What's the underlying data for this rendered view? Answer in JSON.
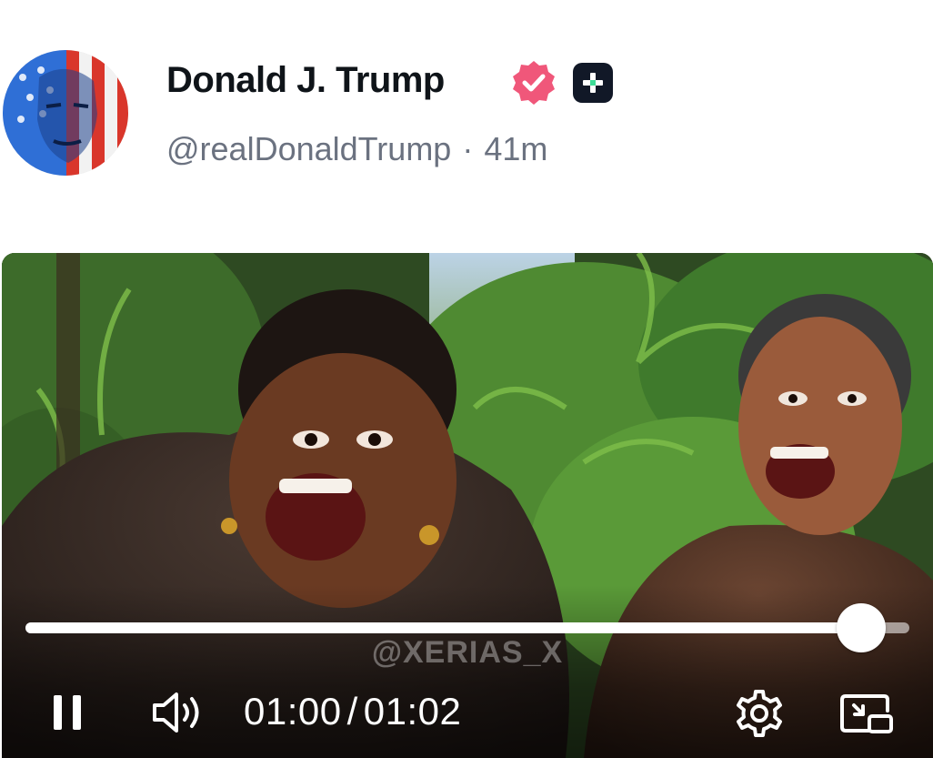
{
  "post": {
    "author": {
      "display_name": "Donald J. Trump",
      "handle": "@realDonaldTrump",
      "separator": "·",
      "time_ago": "41m",
      "verified_icon": "verified-badge-icon",
      "extra_badge_icon": "plus-badge-icon"
    }
  },
  "video": {
    "watermark": "@XERIAS_X",
    "current_time": "01:00",
    "time_separator": "/",
    "duration": "01:02",
    "progress_fraction": 0.945,
    "state": "playing",
    "controls": {
      "pause_icon": "pause-icon",
      "volume_icon": "volume-icon",
      "settings_icon": "gear-icon",
      "pip_icon": "picture-in-picture-icon"
    }
  },
  "colors": {
    "name_text": "#0f1419",
    "meta_text": "#6b7280",
    "verified_badge": "#f0577a",
    "plus_badge_bg": "#111827",
    "plus_badge_accent": "#3ddc97",
    "control_white": "#ffffff"
  }
}
